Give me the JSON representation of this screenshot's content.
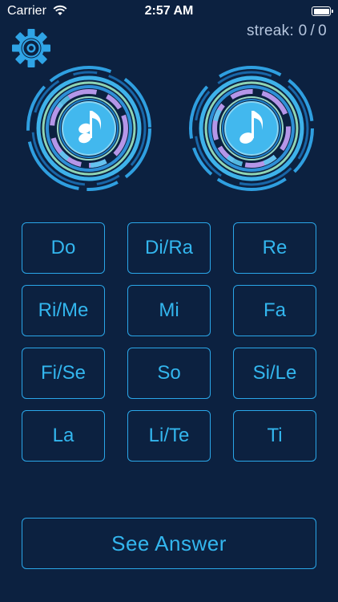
{
  "status_bar": {
    "carrier": "Carrier",
    "time": "2:57 AM",
    "wifi_icon": "wifi-icon",
    "battery_icon": "battery-icon"
  },
  "header": {
    "settings_icon": "gear-icon",
    "streak_label": "streak:",
    "streak_current": "0",
    "streak_separator": "/",
    "streak_total": "0"
  },
  "discs": [
    {
      "name": "chord-disc",
      "icon": "eighth-note-chord-icon"
    },
    {
      "name": "note-disc",
      "icon": "eighth-note-icon"
    }
  ],
  "solfege_buttons": [
    {
      "label": "Do"
    },
    {
      "label": "Di/Ra"
    },
    {
      "label": "Re"
    },
    {
      "label": "Ri/Me"
    },
    {
      "label": "Mi"
    },
    {
      "label": "Fa"
    },
    {
      "label": "Fi/Se"
    },
    {
      "label": "So"
    },
    {
      "label": "Si/Le"
    },
    {
      "label": "La"
    },
    {
      "label": "Li/Te"
    },
    {
      "label": "Ti"
    }
  ],
  "answer_button": {
    "label": "See Answer"
  },
  "colors": {
    "background": "#0c2140",
    "accent": "#33b6ee",
    "button_border": "#2aa6e8",
    "disc_outer": "#2f9fe0",
    "disc_purple": "#b596e8",
    "disc_green": "#8fd4b4",
    "disc_core": "#42b8ee"
  }
}
